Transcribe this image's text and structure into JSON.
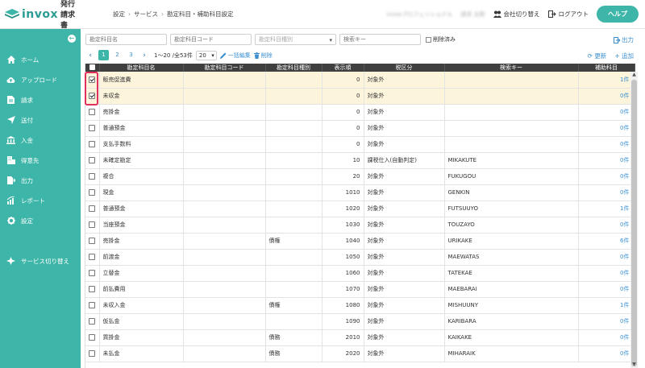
{
  "app": {
    "logo_text": "invox",
    "logo_sub": "発行請求書",
    "brand_color": "#3db5a8"
  },
  "header": {
    "breadcrumb": [
      "設定",
      "サービス",
      "勘定科目・補助科目設定"
    ],
    "company_blurred": "invoxプロフェッショナル",
    "user_blurred": "請求 太郎",
    "switch_company": "会社切り替え",
    "logout": "ログアウト",
    "help": "ヘルプ"
  },
  "sidebar": {
    "items": [
      {
        "label": "ホーム",
        "icon": "home-icon"
      },
      {
        "label": "アップロード",
        "icon": "cloud-upload-icon"
      },
      {
        "label": "請求",
        "icon": "document-icon"
      },
      {
        "label": "送付",
        "icon": "send-icon"
      },
      {
        "label": "入金",
        "icon": "bank-icon"
      },
      {
        "label": "得意先",
        "icon": "building-icon"
      },
      {
        "label": "出力",
        "icon": "export-icon"
      },
      {
        "label": "レポート",
        "icon": "chart-icon"
      },
      {
        "label": "設定",
        "icon": "gear-icon"
      },
      {
        "label": "サービス切り替え",
        "icon": "switch-icon"
      }
    ]
  },
  "filters": {
    "account_name_placeholder": "勘定科目名",
    "account_code_placeholder": "勘定科目コード",
    "account_type_placeholder": "勘定科目種別",
    "search_key_placeholder": "検索キー",
    "include_deleted": "削除済み",
    "export": "出力"
  },
  "toolbar": {
    "pages": [
      "1",
      "2",
      "3"
    ],
    "current_page": "1",
    "page_info": "1〜20 /全53件",
    "per_page": "20",
    "bulk_edit": "一括編集",
    "delete": "削除",
    "refresh": "更新",
    "add": "追加"
  },
  "table": {
    "headers": [
      "勘定科目名",
      "勘定科目コード",
      "勘定科目種別",
      "表示順",
      "税区分",
      "検索キー",
      "補助科目"
    ],
    "rows": [
      {
        "name": "販売促進費",
        "code": "",
        "type": "",
        "order": "0",
        "tax": "対象外",
        "key": "",
        "sub": "1件",
        "checked": true
      },
      {
        "name": "未収金",
        "code": "",
        "type": "",
        "order": "0",
        "tax": "対象外",
        "key": "",
        "sub": "0件",
        "checked": true
      },
      {
        "name": "売掛金",
        "code": "",
        "type": "",
        "order": "0",
        "tax": "対象外",
        "key": "",
        "sub": "0件",
        "checked": false
      },
      {
        "name": "普通預金",
        "code": "",
        "type": "",
        "order": "0",
        "tax": "対象外",
        "key": "",
        "sub": "0件",
        "checked": false
      },
      {
        "name": "支払手数料",
        "code": "",
        "type": "",
        "order": "0",
        "tax": "対象外",
        "key": "",
        "sub": "0件",
        "checked": false
      },
      {
        "name": "未確定勘定",
        "code": "",
        "type": "",
        "order": "10",
        "tax": "課税仕入(自動判定)",
        "key": "MIKAKUTE",
        "sub": "0件",
        "checked": false
      },
      {
        "name": "複合",
        "code": "",
        "type": "",
        "order": "20",
        "tax": "対象外",
        "key": "FUKUGOU",
        "sub": "0件",
        "checked": false
      },
      {
        "name": "現金",
        "code": "",
        "type": "",
        "order": "1010",
        "tax": "対象外",
        "key": "GENKIN",
        "sub": "0件",
        "checked": false
      },
      {
        "name": "普通預金",
        "code": "",
        "type": "",
        "order": "1020",
        "tax": "対象外",
        "key": "FUTSUUYO",
        "sub": "1件",
        "checked": false
      },
      {
        "name": "当座預金",
        "code": "",
        "type": "",
        "order": "1030",
        "tax": "対象外",
        "key": "TOUZAYO",
        "sub": "0件",
        "checked": false
      },
      {
        "name": "売掛金",
        "code": "",
        "type": "債権",
        "order": "1040",
        "tax": "対象外",
        "key": "URIKAKE",
        "sub": "6件",
        "checked": false
      },
      {
        "name": "前渡金",
        "code": "",
        "type": "",
        "order": "1050",
        "tax": "対象外",
        "key": "MAEWATAS",
        "sub": "0件",
        "checked": false
      },
      {
        "name": "立替金",
        "code": "",
        "type": "",
        "order": "1060",
        "tax": "対象外",
        "key": "TATEKAE",
        "sub": "0件",
        "checked": false
      },
      {
        "name": "前払費用",
        "code": "",
        "type": "",
        "order": "1070",
        "tax": "対象外",
        "key": "MAEBARAI",
        "sub": "0件",
        "checked": false
      },
      {
        "name": "未収入金",
        "code": "",
        "type": "債権",
        "order": "1080",
        "tax": "対象外",
        "key": "MISHUUNY",
        "sub": "1件",
        "checked": false
      },
      {
        "name": "仮払金",
        "code": "",
        "type": "",
        "order": "1090",
        "tax": "対象外",
        "key": "KARIBARA",
        "sub": "0件",
        "checked": false
      },
      {
        "name": "買掛金",
        "code": "",
        "type": "債務",
        "order": "2010",
        "tax": "対象外",
        "key": "KAIKAKE",
        "sub": "0件",
        "checked": false
      },
      {
        "name": "未払金",
        "code": "",
        "type": "債務",
        "order": "2020",
        "tax": "対象外",
        "key": "MIHARAIK",
        "sub": "0件",
        "checked": false
      }
    ]
  }
}
